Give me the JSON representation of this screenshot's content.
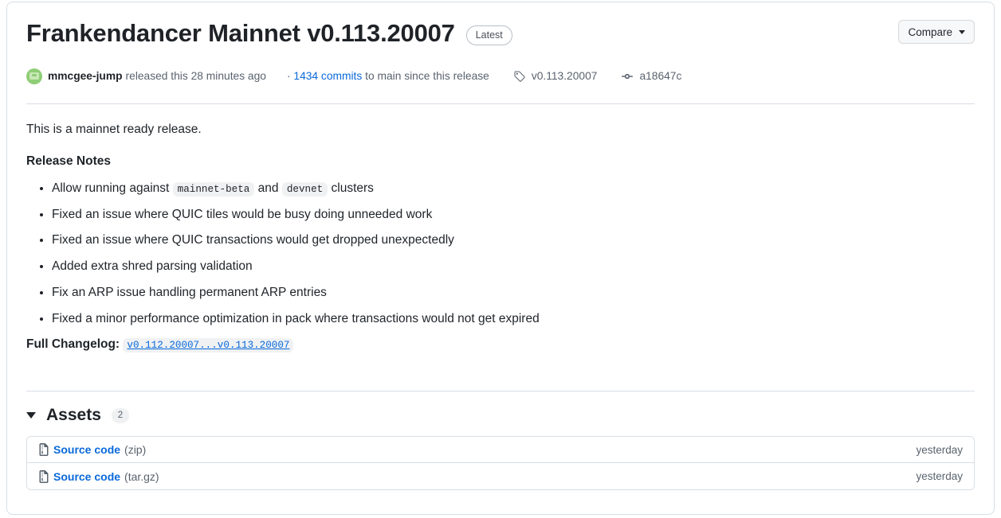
{
  "release": {
    "title": "Frankendancer Mainnet v0.113.20007",
    "latest_badge": "Latest",
    "compare_label": "Compare"
  },
  "meta": {
    "author": "mmcgee-jump",
    "released_text": "released this 28 minutes ago",
    "commits_prefix": "·",
    "commits_link": "1434 commits",
    "commits_suffix": "to main since this release",
    "tag": "v0.113.20007",
    "commit_sha": "a18647c"
  },
  "body": {
    "intro": "This is a mainnet ready release.",
    "notes_heading": "Release Notes",
    "notes": [
      {
        "parts": [
          {
            "type": "text",
            "value": "Allow running against "
          },
          {
            "type": "code",
            "value": "mainnet-beta"
          },
          {
            "type": "text",
            "value": " and "
          },
          {
            "type": "code",
            "value": "devnet"
          },
          {
            "type": "text",
            "value": " clusters"
          }
        ]
      },
      {
        "parts": [
          {
            "type": "text",
            "value": "Fixed an issue where QUIC tiles would be busy doing unneeded work"
          }
        ]
      },
      {
        "parts": [
          {
            "type": "text",
            "value": "Fixed an issue where QUIC transactions would get dropped unexpectedly"
          }
        ]
      },
      {
        "parts": [
          {
            "type": "text",
            "value": "Added extra shred parsing validation"
          }
        ]
      },
      {
        "parts": [
          {
            "type": "text",
            "value": "Fix an ARP issue handling permanent ARP entries"
          }
        ]
      },
      {
        "parts": [
          {
            "type": "text",
            "value": "Fixed a minor performance optimization in pack where transactions would not get expired"
          }
        ]
      }
    ],
    "changelog_label": "Full Changelog:",
    "changelog_link": "v0.112.20007...v0.113.20007"
  },
  "assets": {
    "title": "Assets",
    "count": "2",
    "rows": [
      {
        "name": "Source code",
        "ext": "(zip)",
        "date": "yesterday",
        "icon": "file-zip-icon"
      },
      {
        "name": "Source code",
        "ext": "(tar.gz)",
        "date": "yesterday",
        "icon": "file-zip-icon"
      }
    ]
  },
  "colors": {
    "link": "#0969da",
    "text": "#1f2328",
    "muted": "#59636e",
    "border": "#d8dee4",
    "code_bg": "#eff1f3",
    "avatar_green": "#8fce76"
  }
}
